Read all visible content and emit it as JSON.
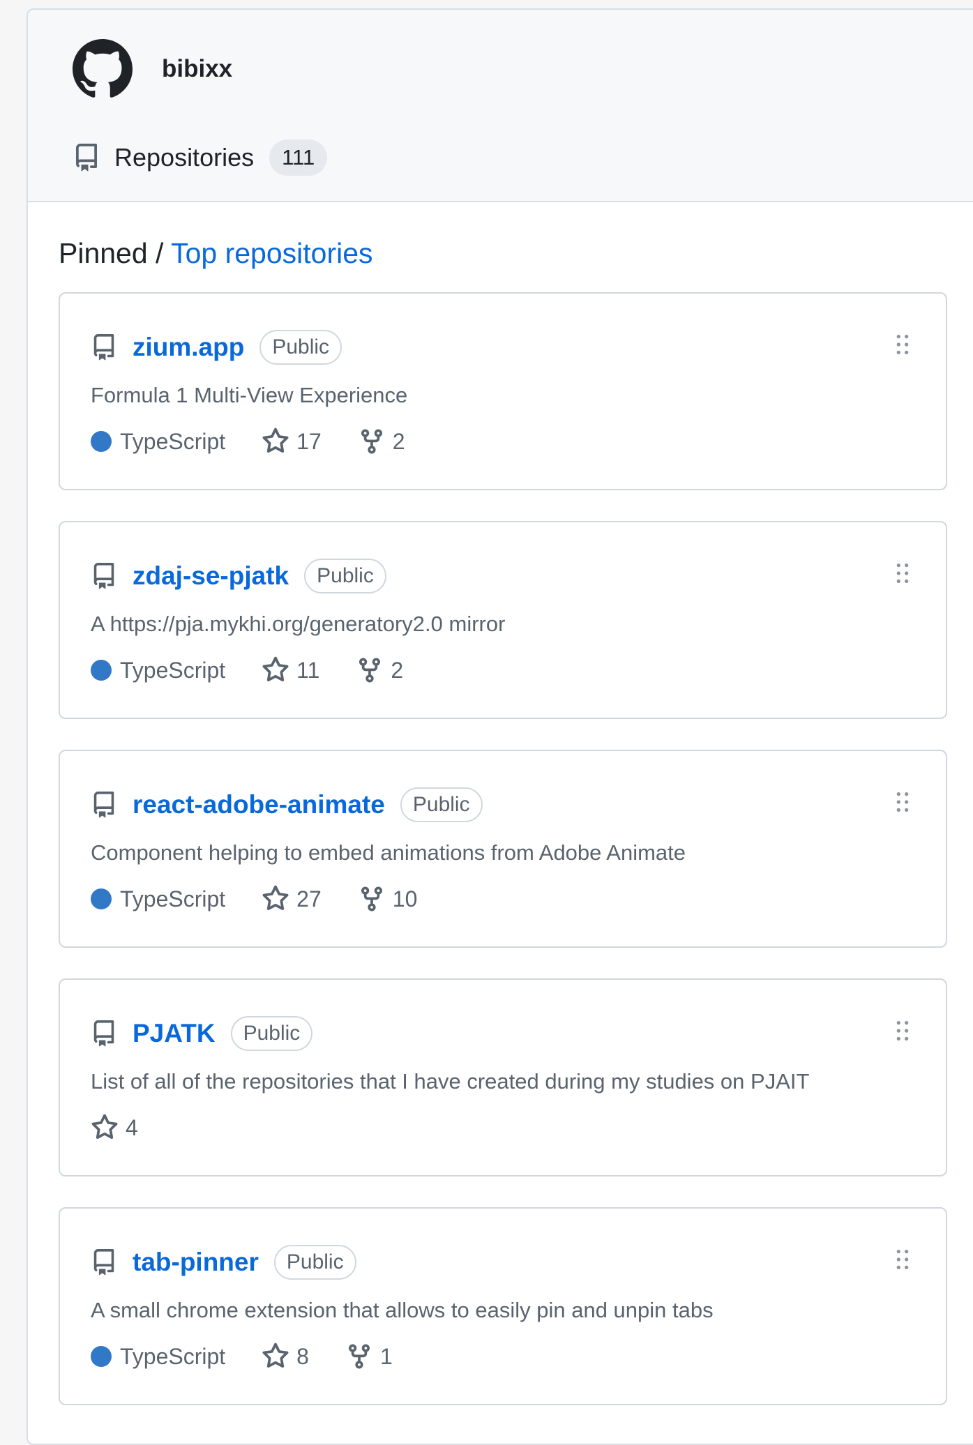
{
  "profile": {
    "username": "bibixx"
  },
  "tabs": {
    "repositories_label": "Repositories",
    "repositories_count": "111"
  },
  "pinned": {
    "title_prefix": "Pinned / ",
    "title_link": "Top repositories"
  },
  "colors": {
    "typescript": "#3178c6",
    "link": "#0969da"
  },
  "repos": [
    {
      "name": "zium.app",
      "visibility": "Public",
      "description": "Formula 1 Multi-View Experience",
      "language": "TypeScript",
      "stars": "17",
      "forks": "2"
    },
    {
      "name": "zdaj-se-pjatk",
      "visibility": "Public",
      "description": "A https://pja.mykhi.org/generatory2.0 mirror",
      "language": "TypeScript",
      "stars": "11",
      "forks": "2"
    },
    {
      "name": "react-adobe-animate",
      "visibility": "Public",
      "description": "Component helping to embed animations from Adobe Animate",
      "language": "TypeScript",
      "stars": "27",
      "forks": "10"
    },
    {
      "name": "PJATK",
      "visibility": "Public",
      "description": "List of all of the repositories that I have created during my studies on PJAIT",
      "stars": "4"
    },
    {
      "name": "tab-pinner",
      "visibility": "Public",
      "description": "A small chrome extension that allows to easily pin and unpin tabs",
      "language": "TypeScript",
      "stars": "8",
      "forks": "1"
    }
  ]
}
